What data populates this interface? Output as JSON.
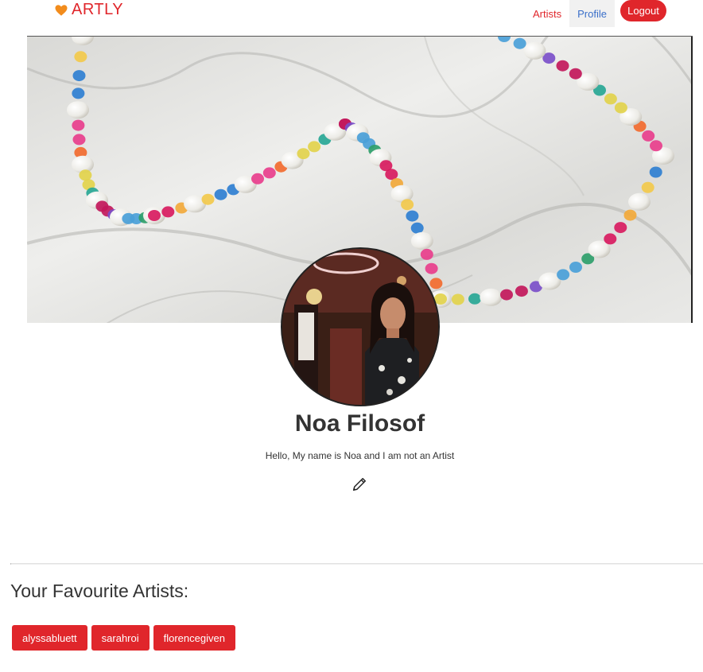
{
  "nav": {
    "brand": "ARTLY",
    "brand_icon": "orange-heart-icon",
    "links": [
      {
        "label": "Artists",
        "active": false
      },
      {
        "label": "Profile",
        "active": true
      }
    ],
    "logout_label": "Logout"
  },
  "profile": {
    "name": "Noa Filosof",
    "bio": "Hello, My name is Noa and I am not an Artist",
    "edit_icon": "pencil-icon"
  },
  "favourites": {
    "title": "Your Favourite Artists:",
    "artists": [
      "alyssabluett",
      "sarahroi",
      "florencegiven"
    ]
  },
  "colors": {
    "accent": "#e0262b",
    "nav_link": "#e0262b",
    "nav_link_active": "#3a6fc9",
    "brand_text": "#e0262b",
    "heart": "#f28c1c"
  }
}
